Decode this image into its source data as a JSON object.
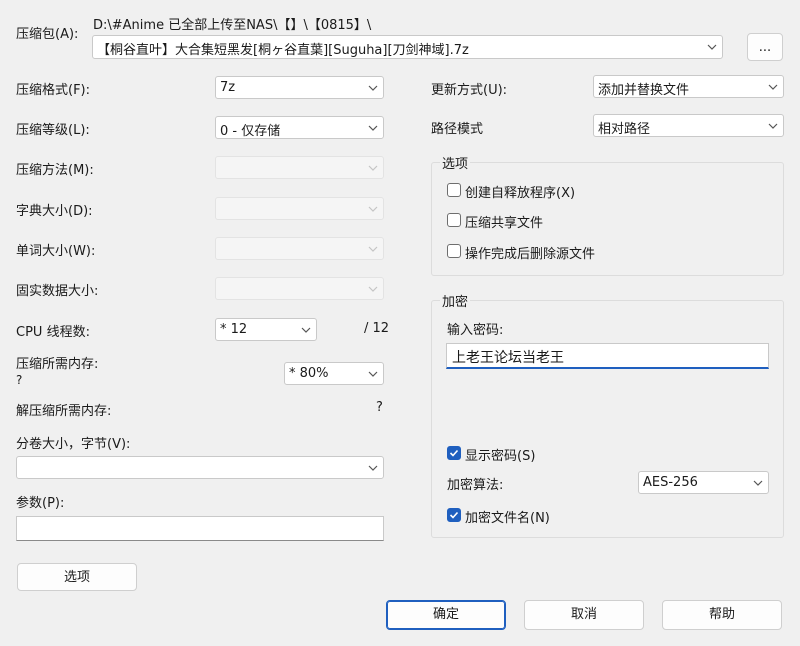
{
  "archive": {
    "label": "压缩包(A):",
    "path": "D:\\#Anime 已全部上传至NAS\\【】\\【0815】\\",
    "filename": "【桐谷直叶】大合集短黑发[桐ヶ谷直葉][Suguha][刀剑神域].7z",
    "browse_label": "..."
  },
  "left": {
    "format": {
      "label": "压缩格式(F):",
      "value": "7z"
    },
    "level": {
      "label": "压缩等级(L):",
      "value": "0 - 仅存储"
    },
    "method": {
      "label": "压缩方法(M):"
    },
    "dict": {
      "label": "字典大小(D):"
    },
    "word": {
      "label": "单词大小(W):"
    },
    "solid": {
      "label": "固实数据大小:"
    },
    "threads": {
      "label": "CPU 线程数:",
      "value": "* 12",
      "max": "/ 12"
    },
    "memory": {
      "label": "压缩所需内存:",
      "value": "* 80%",
      "unknown": "?"
    },
    "decomp": {
      "label": "解压缩所需内存:",
      "value": "?"
    },
    "volume": {
      "label": "分卷大小，字节(V):",
      "value": ""
    },
    "params": {
      "label": "参数(P):",
      "value": ""
    },
    "options_button": "选项"
  },
  "right": {
    "update": {
      "label": "更新方式(U):",
      "value": "添加并替换文件"
    },
    "pathmode": {
      "label": "路径模式",
      "value": "相对路径"
    },
    "options_group": {
      "title": "选项",
      "items": [
        {
          "label": "创建自释放程序(X)",
          "checked": false
        },
        {
          "label": "压缩共享文件",
          "checked": false
        },
        {
          "label": "操作完成后删除源文件",
          "checked": false
        }
      ]
    },
    "encrypt_group": {
      "title": "加密",
      "password_label": "输入密码:",
      "password_value": "上老王论坛当老王",
      "show_password": {
        "label": "显示密码(S)",
        "checked": true
      },
      "method_label": "加密算法:",
      "method_value": "AES-256",
      "encrypt_names": {
        "label": "加密文件名(N)",
        "checked": true
      }
    }
  },
  "footer": {
    "ok": "确定",
    "cancel": "取消",
    "help": "帮助"
  },
  "colors": {
    "accent": "#1f5fbf",
    "background": "#f0f0f0"
  }
}
